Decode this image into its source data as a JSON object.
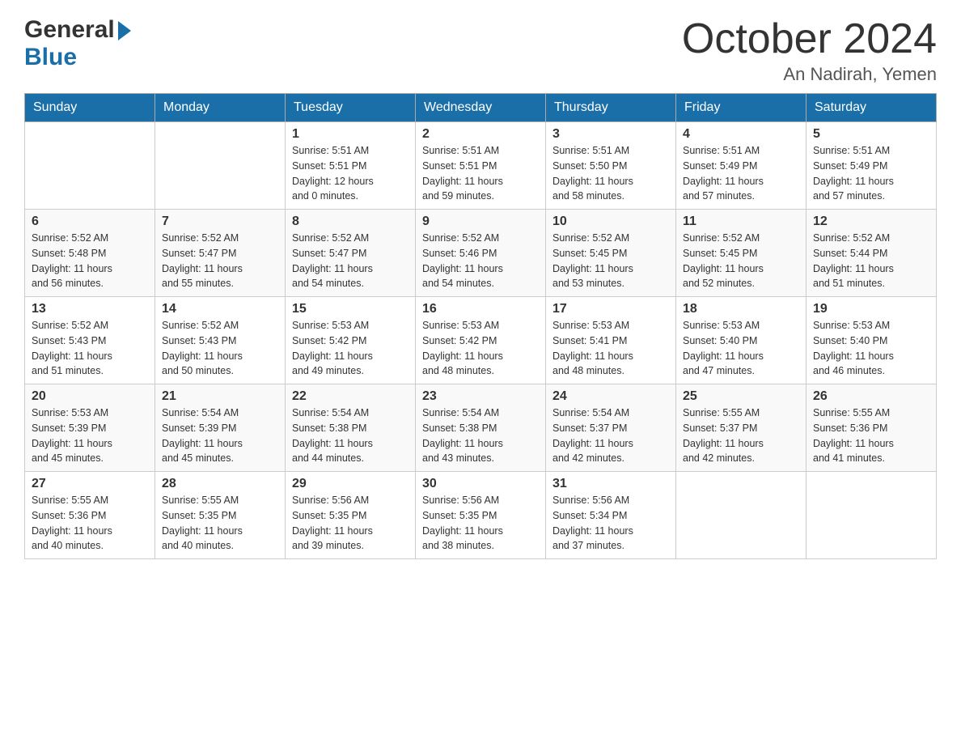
{
  "header": {
    "logo_general": "General",
    "logo_blue": "Blue",
    "title": "October 2024",
    "location": "An Nadirah, Yemen"
  },
  "weekdays": [
    "Sunday",
    "Monday",
    "Tuesday",
    "Wednesday",
    "Thursday",
    "Friday",
    "Saturday"
  ],
  "weeks": [
    [
      {
        "day": "",
        "info": ""
      },
      {
        "day": "",
        "info": ""
      },
      {
        "day": "1",
        "info": "Sunrise: 5:51 AM\nSunset: 5:51 PM\nDaylight: 12 hours\nand 0 minutes."
      },
      {
        "day": "2",
        "info": "Sunrise: 5:51 AM\nSunset: 5:51 PM\nDaylight: 11 hours\nand 59 minutes."
      },
      {
        "day": "3",
        "info": "Sunrise: 5:51 AM\nSunset: 5:50 PM\nDaylight: 11 hours\nand 58 minutes."
      },
      {
        "day": "4",
        "info": "Sunrise: 5:51 AM\nSunset: 5:49 PM\nDaylight: 11 hours\nand 57 minutes."
      },
      {
        "day": "5",
        "info": "Sunrise: 5:51 AM\nSunset: 5:49 PM\nDaylight: 11 hours\nand 57 minutes."
      }
    ],
    [
      {
        "day": "6",
        "info": "Sunrise: 5:52 AM\nSunset: 5:48 PM\nDaylight: 11 hours\nand 56 minutes."
      },
      {
        "day": "7",
        "info": "Sunrise: 5:52 AM\nSunset: 5:47 PM\nDaylight: 11 hours\nand 55 minutes."
      },
      {
        "day": "8",
        "info": "Sunrise: 5:52 AM\nSunset: 5:47 PM\nDaylight: 11 hours\nand 54 minutes."
      },
      {
        "day": "9",
        "info": "Sunrise: 5:52 AM\nSunset: 5:46 PM\nDaylight: 11 hours\nand 54 minutes."
      },
      {
        "day": "10",
        "info": "Sunrise: 5:52 AM\nSunset: 5:45 PM\nDaylight: 11 hours\nand 53 minutes."
      },
      {
        "day": "11",
        "info": "Sunrise: 5:52 AM\nSunset: 5:45 PM\nDaylight: 11 hours\nand 52 minutes."
      },
      {
        "day": "12",
        "info": "Sunrise: 5:52 AM\nSunset: 5:44 PM\nDaylight: 11 hours\nand 51 minutes."
      }
    ],
    [
      {
        "day": "13",
        "info": "Sunrise: 5:52 AM\nSunset: 5:43 PM\nDaylight: 11 hours\nand 51 minutes."
      },
      {
        "day": "14",
        "info": "Sunrise: 5:52 AM\nSunset: 5:43 PM\nDaylight: 11 hours\nand 50 minutes."
      },
      {
        "day": "15",
        "info": "Sunrise: 5:53 AM\nSunset: 5:42 PM\nDaylight: 11 hours\nand 49 minutes."
      },
      {
        "day": "16",
        "info": "Sunrise: 5:53 AM\nSunset: 5:42 PM\nDaylight: 11 hours\nand 48 minutes."
      },
      {
        "day": "17",
        "info": "Sunrise: 5:53 AM\nSunset: 5:41 PM\nDaylight: 11 hours\nand 48 minutes."
      },
      {
        "day": "18",
        "info": "Sunrise: 5:53 AM\nSunset: 5:40 PM\nDaylight: 11 hours\nand 47 minutes."
      },
      {
        "day": "19",
        "info": "Sunrise: 5:53 AM\nSunset: 5:40 PM\nDaylight: 11 hours\nand 46 minutes."
      }
    ],
    [
      {
        "day": "20",
        "info": "Sunrise: 5:53 AM\nSunset: 5:39 PM\nDaylight: 11 hours\nand 45 minutes."
      },
      {
        "day": "21",
        "info": "Sunrise: 5:54 AM\nSunset: 5:39 PM\nDaylight: 11 hours\nand 45 minutes."
      },
      {
        "day": "22",
        "info": "Sunrise: 5:54 AM\nSunset: 5:38 PM\nDaylight: 11 hours\nand 44 minutes."
      },
      {
        "day": "23",
        "info": "Sunrise: 5:54 AM\nSunset: 5:38 PM\nDaylight: 11 hours\nand 43 minutes."
      },
      {
        "day": "24",
        "info": "Sunrise: 5:54 AM\nSunset: 5:37 PM\nDaylight: 11 hours\nand 42 minutes."
      },
      {
        "day": "25",
        "info": "Sunrise: 5:55 AM\nSunset: 5:37 PM\nDaylight: 11 hours\nand 42 minutes."
      },
      {
        "day": "26",
        "info": "Sunrise: 5:55 AM\nSunset: 5:36 PM\nDaylight: 11 hours\nand 41 minutes."
      }
    ],
    [
      {
        "day": "27",
        "info": "Sunrise: 5:55 AM\nSunset: 5:36 PM\nDaylight: 11 hours\nand 40 minutes."
      },
      {
        "day": "28",
        "info": "Sunrise: 5:55 AM\nSunset: 5:35 PM\nDaylight: 11 hours\nand 40 minutes."
      },
      {
        "day": "29",
        "info": "Sunrise: 5:56 AM\nSunset: 5:35 PM\nDaylight: 11 hours\nand 39 minutes."
      },
      {
        "day": "30",
        "info": "Sunrise: 5:56 AM\nSunset: 5:35 PM\nDaylight: 11 hours\nand 38 minutes."
      },
      {
        "day": "31",
        "info": "Sunrise: 5:56 AM\nSunset: 5:34 PM\nDaylight: 11 hours\nand 37 minutes."
      },
      {
        "day": "",
        "info": ""
      },
      {
        "day": "",
        "info": ""
      }
    ]
  ]
}
